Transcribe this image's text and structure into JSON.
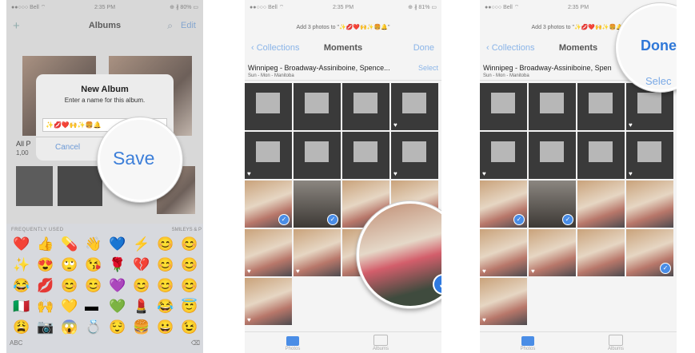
{
  "panel1": {
    "status": {
      "carrier": "●●○○○ Bell ⌔",
      "time": "2:35 PM",
      "battery": "⊕ ∦ 80% ▭"
    },
    "nav": {
      "add": "+",
      "title": "Albums",
      "search": "⌕",
      "edit": "Edit"
    },
    "albums": {
      "label": "All P",
      "count": "1,00"
    },
    "dialog": {
      "title": "New Album",
      "message": "Enter a name for this album.",
      "input_value": "✨💋❤️🙌✨🍔🔔",
      "cancel": "Cancel",
      "save": "Save"
    },
    "keyboard": {
      "section_left": "FREQUENTLY USED",
      "section_right": "SMILEYS & P",
      "rows": [
        [
          "❤️",
          "👍",
          "💊",
          "👋",
          "💙",
          "⚡",
          "😊",
          "😊"
        ],
        [
          "✨",
          "😍",
          "🙄",
          "😘",
          "🌹",
          "💔",
          "😊",
          "😊"
        ],
        [
          "😂",
          "💋",
          "😊",
          "😊",
          "💜",
          "😊",
          "😊",
          "😊"
        ],
        [
          "🇮🇹",
          "🙌",
          "💛",
          "▬",
          "💚",
          "💄",
          "😂",
          "😇"
        ],
        [
          "😩",
          "📷",
          "😱",
          "💍",
          "😌",
          "🍔",
          "😀",
          "😉"
        ]
      ],
      "abc": "ABC"
    }
  },
  "panel2": {
    "status": {
      "carrier": "●●○○○ Bell ⌔",
      "time": "2:35 PM",
      "battery": "⊕ ∦ 81% ▭"
    },
    "banner": "Add 3 photos to \"✨💋❤️🙌✨🍔🔔\"",
    "nav": {
      "back": "‹ Collections",
      "title": "Moments",
      "done": "Done"
    },
    "header": {
      "title": "Winnipeg - Broadway-Assiniboine, Spence...",
      "subtitle": "Sun - Mon - Manitoba",
      "select": "Select"
    },
    "tabs": {
      "photos": "Photos",
      "albums": "Albums"
    }
  },
  "panel3": {
    "status": {
      "carrier": "●●○○○ Bell ⌔",
      "time": "2:35 PM"
    },
    "banner": "Add 3 photos to \"✨💋❤️🙌✨🍔🔔\"",
    "nav": {
      "back": "‹ Collections",
      "title": "Moments",
      "done": "Done"
    },
    "header": {
      "title": "Winnipeg - Broadway-Assiniboine, Spen",
      "subtitle": "Sun - Mon - Manitoba",
      "select": "Selec"
    },
    "tabs": {
      "photos": "Photos",
      "albums": "Albums"
    }
  },
  "colors": {
    "accent": "#2f78d8",
    "light_accent": "#8ab4e8"
  }
}
